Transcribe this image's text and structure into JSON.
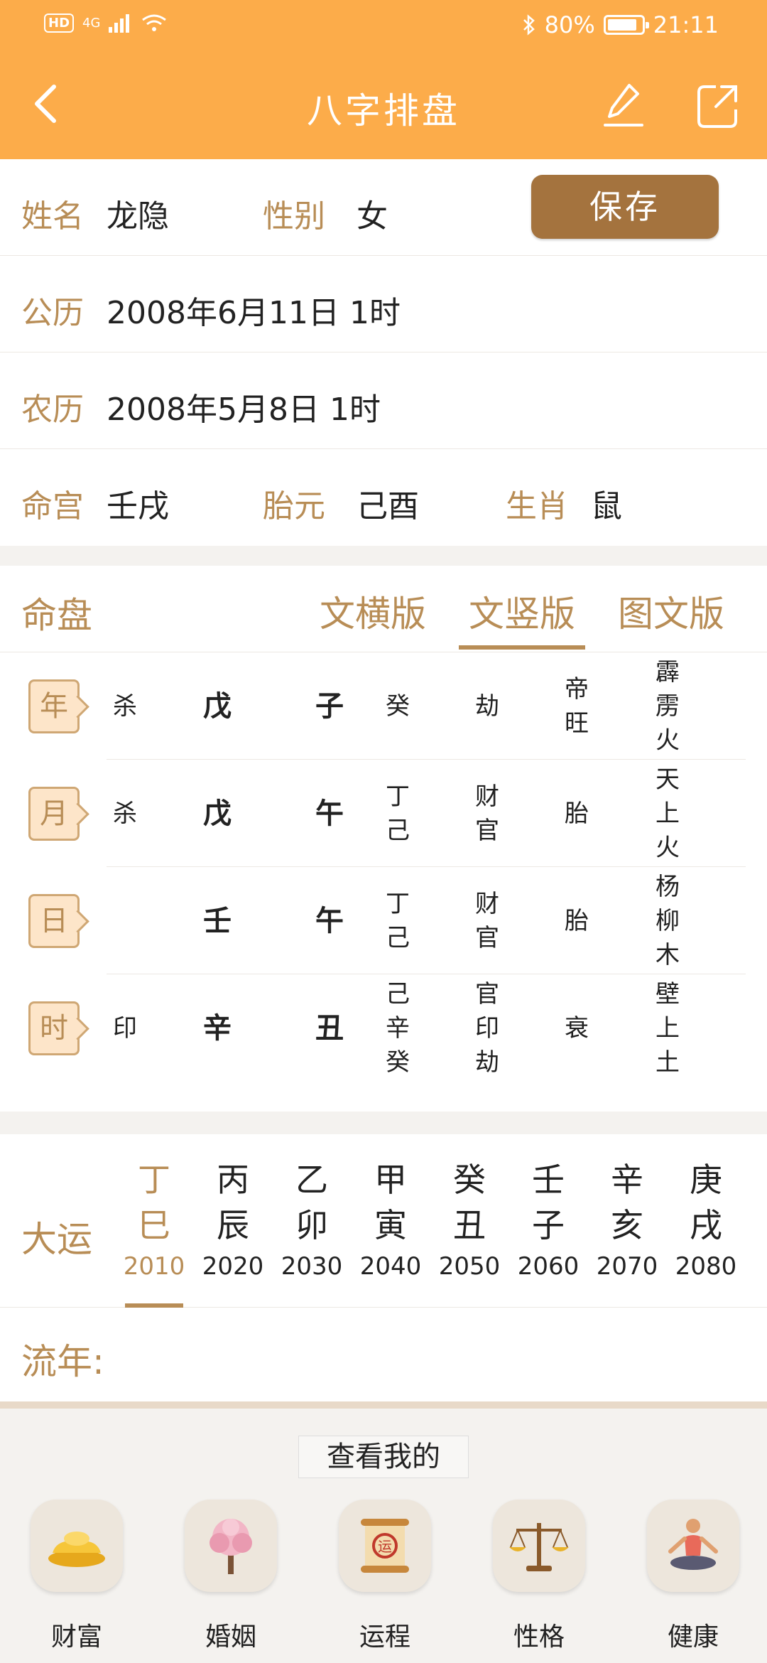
{
  "status": {
    "signal": "4G",
    "hd": "HD",
    "battery": "80%",
    "time": "21:11"
  },
  "header": {
    "title": "八字排盘"
  },
  "info": {
    "name_label": "姓名",
    "name": "龙隐",
    "gender_label": "性别",
    "gender": "女",
    "save_label": "保存",
    "solar_label": "公历",
    "solar": "2008年6月11日 1时",
    "lunar_label": "农历",
    "lunar": "2008年5月8日 1时",
    "minggong_label": "命宫",
    "minggong": "壬戌",
    "taiyuan_label": "胎元",
    "taiyuan": "己酉",
    "zodiac_label": "生肖",
    "zodiac": "鼠"
  },
  "chart": {
    "title": "命盘",
    "tabs": [
      "文横版",
      "文竖版",
      "图文版"
    ],
    "active_tab": 1,
    "pillars": [
      {
        "label": "年",
        "shishen": "杀",
        "gan": "戊",
        "zhi": "子",
        "canggan": [
          "癸"
        ],
        "cangshen": [
          "劫"
        ],
        "state": [
          "帝",
          "旺"
        ],
        "nayin": [
          "霹",
          "雳",
          "火"
        ]
      },
      {
        "label": "月",
        "shishen": "杀",
        "gan": "戊",
        "zhi": "午",
        "canggan": [
          "丁",
          "己"
        ],
        "cangshen": [
          "财",
          "官"
        ],
        "state": [
          "胎"
        ],
        "nayin": [
          "天",
          "上",
          "火"
        ]
      },
      {
        "label": "日",
        "shishen": "",
        "gan": "壬",
        "zhi": "午",
        "canggan": [
          "丁",
          "己"
        ],
        "cangshen": [
          "财",
          "官"
        ],
        "state": [
          "胎"
        ],
        "nayin": [
          "杨",
          "柳",
          "木"
        ]
      },
      {
        "label": "时",
        "shishen": "印",
        "gan": "辛",
        "zhi": "丑",
        "canggan": [
          "己",
          "辛",
          "癸"
        ],
        "cangshen": [
          "官",
          "印",
          "劫"
        ],
        "state": [
          "衰"
        ],
        "nayin": [
          "壁",
          "上",
          "土"
        ]
      }
    ]
  },
  "luck": {
    "label": "大运",
    "columns": [
      {
        "top": "丁",
        "bottom": "巳",
        "year": "2010"
      },
      {
        "top": "丙",
        "bottom": "辰",
        "year": "2020"
      },
      {
        "top": "乙",
        "bottom": "卯",
        "year": "2030"
      },
      {
        "top": "甲",
        "bottom": "寅",
        "year": "2040"
      },
      {
        "top": "癸",
        "bottom": "丑",
        "year": "2050"
      },
      {
        "top": "壬",
        "bottom": "子",
        "year": "2060"
      },
      {
        "top": "辛",
        "bottom": "亥",
        "year": "2070"
      },
      {
        "top": "庚",
        "bottom": "戌",
        "year": "2080"
      }
    ],
    "active": 0,
    "flow_label": "流年:"
  },
  "bottom": {
    "view_mine": "查看我的",
    "categories": [
      {
        "label": "财富",
        "icon": "gold-ingot-icon"
      },
      {
        "label": "婚姻",
        "icon": "blossom-tree-icon"
      },
      {
        "label": "运程",
        "icon": "scroll-icon"
      },
      {
        "label": "性格",
        "icon": "scales-icon"
      },
      {
        "label": "健康",
        "icon": "yoga-icon"
      }
    ]
  }
}
